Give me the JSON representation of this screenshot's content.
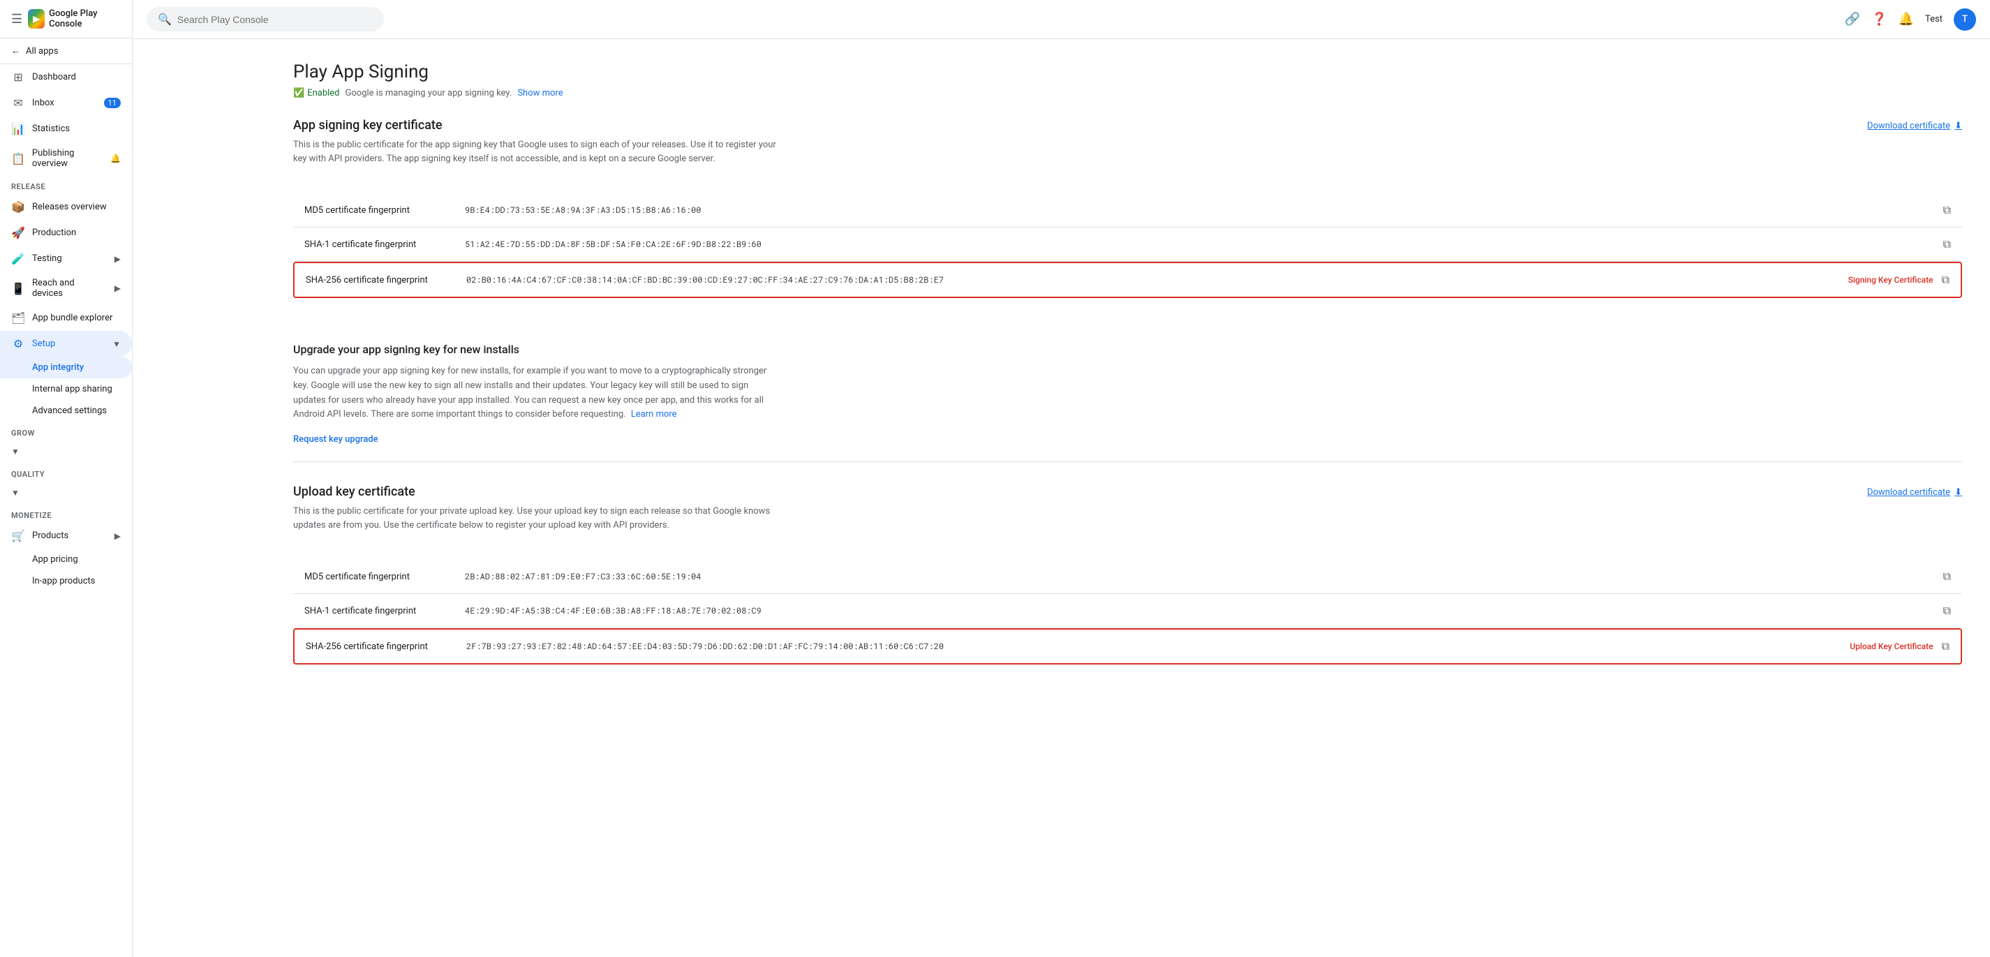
{
  "app": {
    "name": "Google Play Console"
  },
  "topbar": {
    "search_placeholder": "Search Play Console",
    "account_label": "Test",
    "link_icon": "🔗",
    "help_icon": "?",
    "notifications_icon": "🔔"
  },
  "sidebar": {
    "all_apps_label": "All apps",
    "nav_items": [
      {
        "id": "dashboard",
        "label": "Dashboard",
        "icon": "⊞"
      },
      {
        "id": "inbox",
        "label": "Inbox",
        "icon": "✉",
        "badge": "11"
      },
      {
        "id": "statistics",
        "label": "Statistics",
        "icon": "📊"
      },
      {
        "id": "publishing-overview",
        "label": "Publishing overview",
        "icon": "📋",
        "extra_icon": "🔔"
      }
    ],
    "release_section": "Release",
    "release_items": [
      {
        "id": "releases-overview",
        "label": "Releases overview",
        "icon": "📦"
      },
      {
        "id": "production",
        "label": "Production",
        "icon": "🚀"
      },
      {
        "id": "testing",
        "label": "Testing",
        "icon": "🧪",
        "has_arrow": true
      },
      {
        "id": "reach-and-devices",
        "label": "Reach and devices",
        "icon": "📱",
        "has_arrow": true
      },
      {
        "id": "app-bundle-explorer",
        "label": "App bundle explorer",
        "icon": "🗂"
      },
      {
        "id": "setup",
        "label": "Setup",
        "icon": "⚙",
        "active": true,
        "has_arrow": true
      }
    ],
    "setup_sub_items": [
      {
        "id": "app-integrity",
        "label": "App integrity",
        "active": true
      },
      {
        "id": "internal-app-sharing",
        "label": "Internal app sharing"
      },
      {
        "id": "advanced-settings",
        "label": "Advanced settings"
      }
    ],
    "grow_section": "Grow",
    "quality_section": "Quality",
    "monetize_section": "Monetize",
    "monetize_items": [
      {
        "id": "products",
        "label": "Products",
        "icon": "🛒",
        "has_arrow": true
      },
      {
        "id": "app-pricing",
        "label": "App pricing"
      },
      {
        "id": "in-app-products",
        "label": "In-app products"
      }
    ]
  },
  "page": {
    "title": "Play App Signing",
    "subtitle_enabled": "Enabled",
    "subtitle_desc": "Google is managing your app signing key.",
    "show_more": "Show more"
  },
  "app_signing_section": {
    "title": "App signing key certificate",
    "description": "This is the public certificate for the app signing key that Google uses to sign each of your releases. Use it to register your key with API providers. The app signing key itself is not accessible, and is kept on a secure Google server.",
    "download_label": "Download certificate",
    "rows": [
      {
        "label": "MD5 certificate fingerprint",
        "value": "9B:E4:DD:73:53:5E:A8:9A:3F:A3:D5:15:B8:A6:16:00",
        "highlighted": false,
        "tag": ""
      },
      {
        "label": "SHA-1 certificate fingerprint",
        "value": "51:A2:4E:7D:55:DD:DA:8F:5B:DF:5A:F0:CA:2E:6F:9D:B8:22:B9:60",
        "highlighted": false,
        "tag": ""
      },
      {
        "label": "SHA-256 certificate fingerprint",
        "value": "02:B0:16:4A:C4:67:CF:C0:38:14:0A:CF:BD:BC:39:00:CD:E9:27:0C:FF:34:AE:27:C9:76:DA:A1:D5:B8:2B:E7",
        "highlighted": true,
        "tag": "Signing Key Certificate"
      }
    ]
  },
  "upgrade_section": {
    "title": "Upgrade your app signing key for new installs",
    "description": "You can upgrade your app signing key for new installs, for example if you want to move to a cryptographically stronger key. Google will use the new key to sign all new installs and their updates. Your legacy key will still be used to sign updates for users who already have your app installed. You can request a new key once per app, and this works for all Android API levels. There are some important things to consider before requesting.",
    "learn_more": "Learn more",
    "request_label": "Request key upgrade"
  },
  "upload_key_section": {
    "title": "Upload key certificate",
    "description": "This is the public certificate for your private upload key. Use your upload key to sign each release so that Google knows updates are from you. Use the certificate below to register your upload key with API providers.",
    "download_label": "Download certificate",
    "rows": [
      {
        "label": "MD5 certificate fingerprint",
        "value": "2B:AD:88:02:A7:81:D9:E0:F7:C3:33:6C:60:5E:19:04",
        "highlighted": false,
        "tag": ""
      },
      {
        "label": "SHA-1 certificate fingerprint",
        "value": "4E:29:9D:4F:A5:3B:C4:4F:E0:6B:3B:A8:FF:18:A8:7E:70:02:08:C9",
        "highlighted": false,
        "tag": ""
      },
      {
        "label": "SHA-256 certificate fingerprint",
        "value": "2F:7B:93:27:93:E7:82:48:AD:64:57:EE:D4:03:5D:79:D6:DD:62:D0:D1:AF:FC:79:14:00:AB:11:60:C6:C7:20",
        "highlighted": true,
        "tag": "Upload Key Certificate"
      }
    ]
  }
}
